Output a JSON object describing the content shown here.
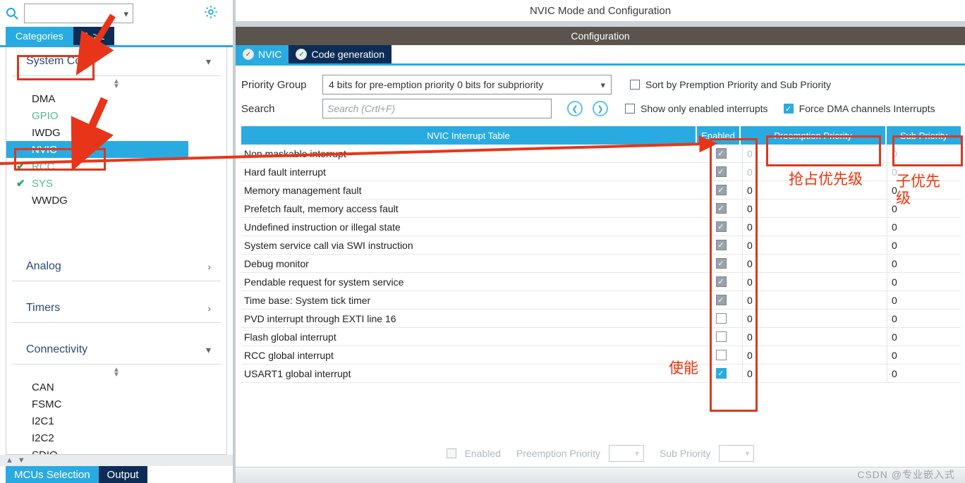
{
  "left_panel": {
    "search": {
      "placeholder": "",
      "value": "",
      "icon": "search-icon"
    },
    "gear_icon": "gear-icon",
    "tabs": [
      {
        "label": "Categories",
        "active": true
      },
      {
        "label": "A->Z",
        "active": false
      }
    ],
    "groups": [
      {
        "title": "System Core",
        "expanded": true,
        "items": [
          {
            "label": "DMA",
            "state": "plain"
          },
          {
            "label": "GPIO",
            "state": "green"
          },
          {
            "label": "IWDG",
            "state": "plain"
          },
          {
            "label": "NVIC",
            "state": "selected"
          },
          {
            "label": "RCC",
            "state": "green-check"
          },
          {
            "label": "SYS",
            "state": "green-check"
          },
          {
            "label": "WWDG",
            "state": "plain"
          }
        ]
      },
      {
        "title": "Analog",
        "expanded": false,
        "items": []
      },
      {
        "title": "Timers",
        "expanded": false,
        "items": []
      },
      {
        "title": "Connectivity",
        "expanded": true,
        "items": [
          {
            "label": "CAN",
            "state": "plain"
          },
          {
            "label": "FSMC",
            "state": "plain"
          },
          {
            "label": "I2C1",
            "state": "plain"
          },
          {
            "label": "I2C2",
            "state": "plain"
          },
          {
            "label": "SDIO",
            "state": "plain"
          }
        ]
      }
    ],
    "bottom_tabs": [
      {
        "label": "MCUs Selection",
        "active": true
      },
      {
        "label": "Output",
        "active": false
      }
    ]
  },
  "right_panel": {
    "page_title": "NVIC Mode and Configuration",
    "configuration_bar": "Configuration",
    "tabs": [
      {
        "label": "NVIC",
        "active": true
      },
      {
        "label": "Code generation",
        "active": false
      }
    ],
    "priority_group": {
      "label": "Priority Group",
      "value": "4 bits for pre-emption priority 0 bits for subpriority"
    },
    "search": {
      "label": "Search",
      "value": "",
      "placeholder": "Search (Crtl+F)",
      "prev_icon": "chevron-left-circle-icon",
      "next_icon": "chevron-right-circle-icon"
    },
    "checkboxes": {
      "sort_by": {
        "label": "Sort by Premption Priority and Sub Priority",
        "checked": false
      },
      "show_only_enabled": {
        "label": "Show only enabled interrupts",
        "checked": false
      },
      "force_dma": {
        "label": "Force DMA channels Interrupts",
        "checked": true
      }
    },
    "table": {
      "headers": [
        "NVIC Interrupt Table",
        "Enabled",
        "Preemption Priority",
        "Sub Priority"
      ],
      "rows": [
        {
          "name": "Non maskable interrupt",
          "enabled": "grey",
          "preemption": "0",
          "sub": "0",
          "dim": true
        },
        {
          "name": "Hard fault interrupt",
          "enabled": "grey",
          "preemption": "0",
          "sub": "0",
          "dim": true
        },
        {
          "name": "Memory management fault",
          "enabled": "grey",
          "preemption": "0",
          "sub": "0",
          "dim": false
        },
        {
          "name": "Prefetch fault, memory access fault",
          "enabled": "grey",
          "preemption": "0",
          "sub": "0",
          "dim": false
        },
        {
          "name": "Undefined instruction or illegal state",
          "enabled": "grey",
          "preemption": "0",
          "sub": "0",
          "dim": false
        },
        {
          "name": "System service call via SWI instruction",
          "enabled": "grey",
          "preemption": "0",
          "sub": "0",
          "dim": false
        },
        {
          "name": "Debug monitor",
          "enabled": "grey",
          "preemption": "0",
          "sub": "0",
          "dim": false
        },
        {
          "name": "Pendable request for system service",
          "enabled": "grey",
          "preemption": "0",
          "sub": "0",
          "dim": false
        },
        {
          "name": "Time base: System tick timer",
          "enabled": "grey",
          "preemption": "0",
          "sub": "0",
          "dim": false
        },
        {
          "name": "PVD interrupt through EXTI line 16",
          "enabled": "off",
          "preemption": "0",
          "sub": "0",
          "dim": false
        },
        {
          "name": "Flash global interrupt",
          "enabled": "off",
          "preemption": "0",
          "sub": "0",
          "dim": false
        },
        {
          "name": "RCC global interrupt",
          "enabled": "off",
          "preemption": "0",
          "sub": "0",
          "dim": false
        },
        {
          "name": "USART1 global interrupt",
          "enabled": "blue",
          "preemption": "0",
          "sub": "0",
          "dim": false
        }
      ]
    },
    "editor": {
      "enabled_label": "Enabled",
      "enabled_checked": false,
      "preemption_label": "Preemption Priority",
      "preemption_value": "",
      "sub_label": "Sub Priority",
      "sub_value": ""
    },
    "watermark": "CSDN @专业嵌入式"
  },
  "annotations": {
    "color": "#d93a1f",
    "preemption_note": "抢占优先级",
    "sub_note": "子优先\n级",
    "enable_note": "使能"
  }
}
